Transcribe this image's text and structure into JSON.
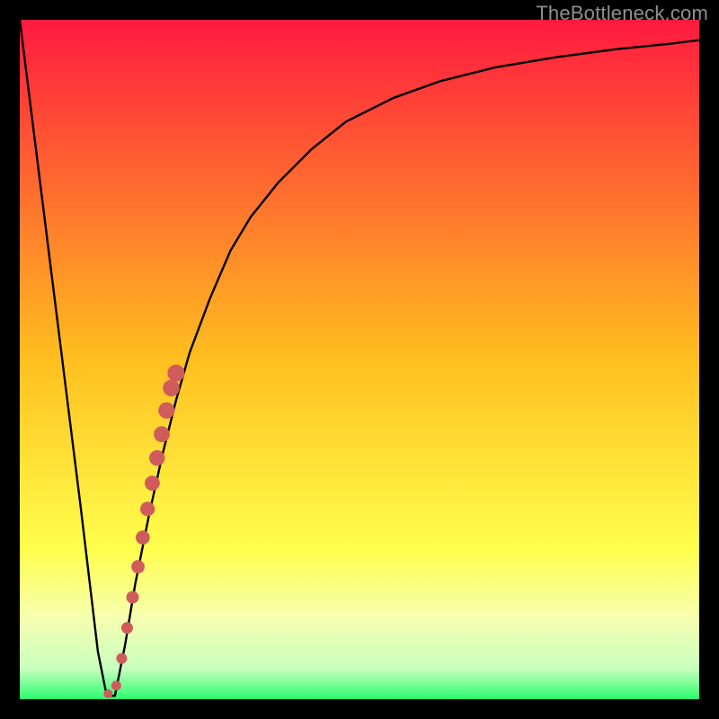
{
  "watermark": "TheBottleneck.com",
  "colors": {
    "frame": "#000000",
    "curve": "#000000",
    "dots": "#cf5b5b",
    "gradient_stops": [
      {
        "offset": 0.0,
        "color": "#ff1a3f"
      },
      {
        "offset": 0.5,
        "color": "#ffbf1f"
      },
      {
        "offset": 0.78,
        "color": "#ffff4d"
      },
      {
        "offset": 0.88,
        "color": "#f6ffb0"
      },
      {
        "offset": 0.955,
        "color": "#c8ffbf"
      },
      {
        "offset": 1.0,
        "color": "#2bfd6e"
      }
    ]
  },
  "chart_data": {
    "type": "line",
    "title": "",
    "xlabel": "",
    "ylabel": "",
    "xlim": [
      0,
      100
    ],
    "ylim": [
      0,
      100
    ],
    "series": [
      {
        "name": "bottleneck-curve",
        "x": [
          0,
          3,
          6,
          9,
          11.5,
          12.8,
          14,
          15.5,
          17,
          19,
          21,
          23,
          25,
          28,
          31,
          34,
          38,
          43,
          48,
          55,
          62,
          70,
          79,
          88,
          96,
          100
        ],
        "y": [
          100,
          76,
          52,
          28,
          7,
          0.5,
          0.5,
          8,
          17,
          27,
          36,
          44,
          51,
          59,
          66,
          71,
          76,
          81,
          85,
          88.5,
          91,
          93,
          94.5,
          95.7,
          96.5,
          97
        ]
      }
    ],
    "scatter": {
      "name": "highlight-dots",
      "x": [
        13.0,
        14.2,
        15.0,
        15.8,
        16.6,
        17.4,
        18.1,
        18.8,
        19.5,
        20.2,
        20.9,
        21.6,
        22.3,
        23.0
      ],
      "y": [
        0.8,
        2.0,
        6.0,
        10.5,
        15.0,
        19.5,
        23.8,
        28.0,
        31.8,
        35.5,
        39.0,
        42.5,
        45.8,
        48.0
      ],
      "r": [
        5.0,
        5.5,
        6.0,
        6.5,
        7.0,
        7.4,
        7.8,
        8.1,
        8.4,
        8.7,
        8.9,
        9.1,
        9.3,
        9.5
      ]
    }
  }
}
